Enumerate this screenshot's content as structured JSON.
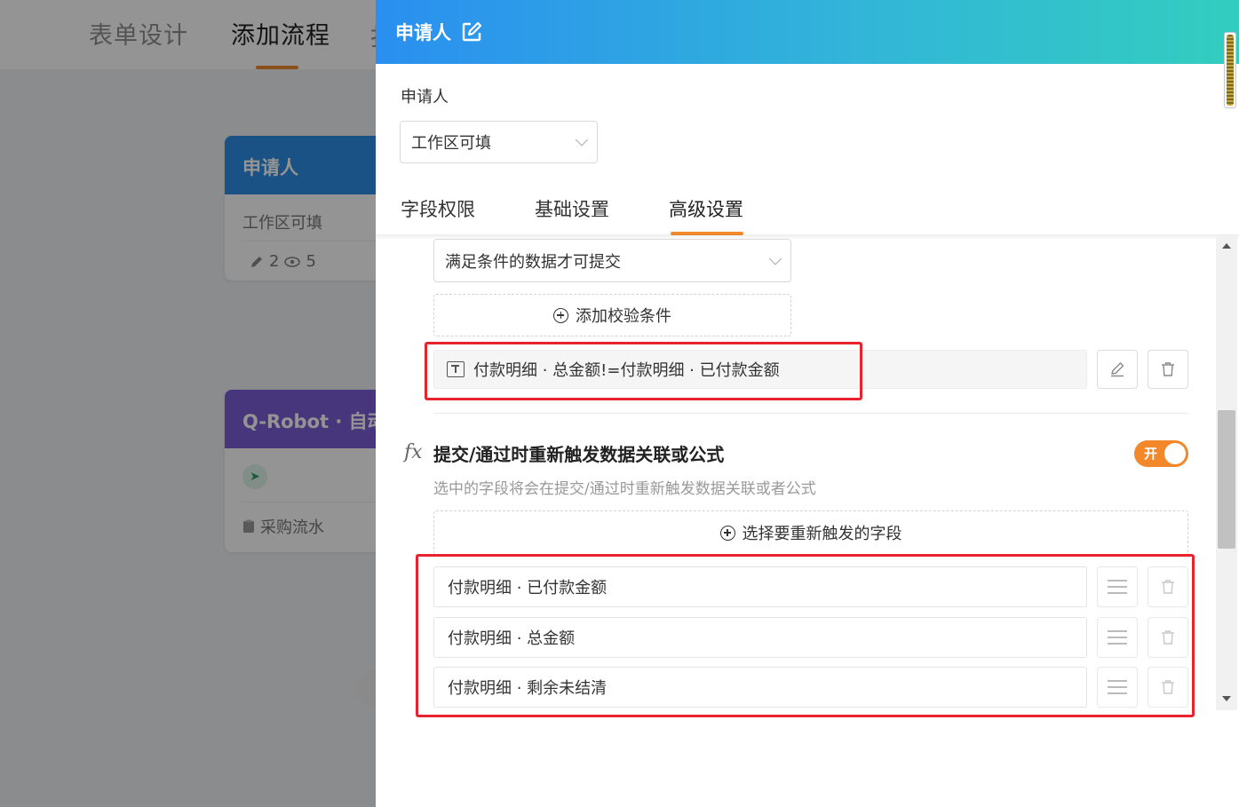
{
  "background": {
    "tabs": [
      {
        "label": "表单设计",
        "active": false
      },
      {
        "label": "添加流程",
        "active": true
      },
      {
        "label": "扌",
        "active": false
      }
    ],
    "card_applicant": {
      "title": "申请人",
      "permission": "工作区可填",
      "edit_count": "2",
      "view_count": "5"
    },
    "card_robot": {
      "title": "Q-Robot · 自动",
      "item": "采购流水"
    },
    "bottom_glyph": "纟"
  },
  "drawer": {
    "title": "申请人",
    "applicant_label": "申请人",
    "permission_select": {
      "value": "工作区可填"
    },
    "tabs": [
      {
        "label": "字段权限",
        "active": false
      },
      {
        "label": "基础设置",
        "active": false
      },
      {
        "label": "高级设置",
        "active": true
      }
    ],
    "validation": {
      "mode_select": {
        "value": "满足条件的数据才可提交"
      },
      "add_button": "添加校验条件",
      "rules": [
        {
          "text": "付款明细 · 总金额!=付款明细 · 已付款金额"
        }
      ]
    },
    "retrigger": {
      "icon": "fx-icon",
      "title": "提交/通过时重新触发数据关联或公式",
      "description": "选中的字段将会在提交/通过时重新触发数据关联或者公式",
      "switch": {
        "label": "开",
        "on": true
      },
      "select_button": "选择要重新触发的字段",
      "fields": [
        {
          "label": "付款明细 · 已付款金额"
        },
        {
          "label": "付款明细 · 总金额"
        },
        {
          "label": "付款明细 · 剩余未结清"
        }
      ]
    }
  },
  "colors": {
    "accent_orange": "#f2882a",
    "header_gradient_start": "#2a8ff0",
    "header_gradient_end": "#33cdbf",
    "annotation_red": "#e8232d"
  }
}
